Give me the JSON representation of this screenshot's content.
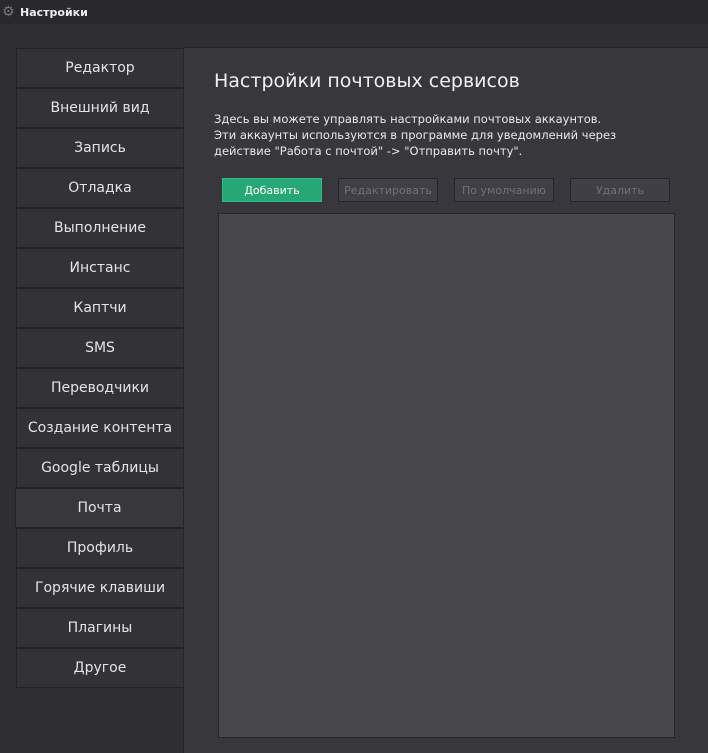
{
  "window": {
    "title": "Настройки",
    "icon": "gear-icon"
  },
  "sidebar": {
    "items": [
      {
        "label": "Редактор"
      },
      {
        "label": "Внешний вид"
      },
      {
        "label": "Запись"
      },
      {
        "label": "Отладка"
      },
      {
        "label": "Выполнение"
      },
      {
        "label": "Инстанс"
      },
      {
        "label": "Каптчи"
      },
      {
        "label": "SMS"
      },
      {
        "label": "Переводчики"
      },
      {
        "label": "Создание контента"
      },
      {
        "label": "Google таблицы"
      },
      {
        "label": "Почта",
        "active": true
      },
      {
        "label": "Профиль"
      },
      {
        "label": "Горячие клавиши"
      },
      {
        "label": "Плагины"
      },
      {
        "label": "Другое"
      }
    ]
  },
  "main": {
    "title": "Настройки почтовых сервисов",
    "description": [
      "Здесь вы можете управлять настройками почтовых аккаунтов.",
      "Эти аккаунты используются в программе для уведомлений через",
      "действие \"Работа с почтой\" -> \"Отправить почту\"."
    ],
    "buttons": {
      "add": "Добавить",
      "edit": "Редактировать",
      "default": "По умолчанию",
      "delete": "Удалить"
    },
    "accent": "#27a676"
  }
}
